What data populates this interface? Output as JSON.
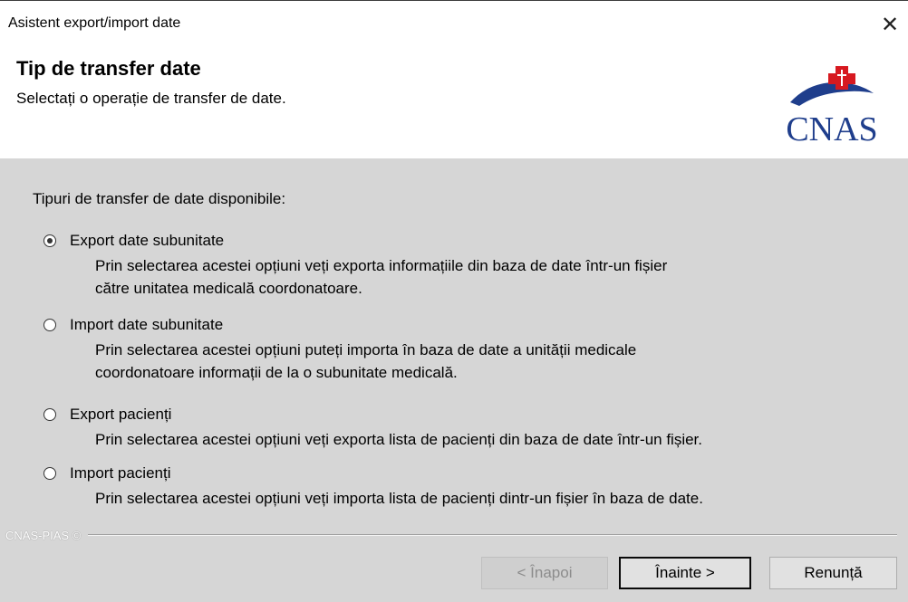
{
  "window": {
    "title": "Asistent export/import date"
  },
  "header": {
    "title": "Tip de transfer date",
    "subtitle": "Selectați o operație de transfer de date.",
    "logo_text": "CNAS"
  },
  "content": {
    "group_label": "Tipuri de transfer de date disponibile:",
    "options": [
      {
        "label": "Export date subunitate",
        "checked": true,
        "desc_lines": [
          "Prin selectarea acestei opțiuni veți exporta informațiile din baza de date într-un fișier",
          "către unitatea medicală coordonatoare."
        ]
      },
      {
        "label": "Import date subunitate",
        "checked": false,
        "desc_lines": [
          "Prin selectarea acestei opțiuni puteți importa în baza de date a unității medicale",
          "coordonatoare informații de la o subunitate medicală."
        ]
      },
      {
        "label": "Export pacienți",
        "checked": false,
        "desc_lines": [
          "Prin selectarea acestei opțiuni veți exporta lista de pacienți din baza de date într-un fișier."
        ]
      },
      {
        "label": "Import pacienți",
        "checked": false,
        "desc_lines": [
          "Prin selectarea acestei opțiuni veți importa lista de pacienți dintr-un fișier în baza de date."
        ]
      }
    ]
  },
  "footer": {
    "brand": "CNAS-PIAS ©",
    "back_label": "< Înapoi",
    "next_label": "Înainte >",
    "cancel_label": "Renunță"
  },
  "colors": {
    "logo_blue": "#1f3e8c",
    "logo_red": "#d71920",
    "panel_bg": "#d6d6d6"
  },
  "icons": {
    "close": "close-icon",
    "radio_selected": "radio-selected-icon",
    "radio_unselected": "radio-unselected-icon"
  }
}
